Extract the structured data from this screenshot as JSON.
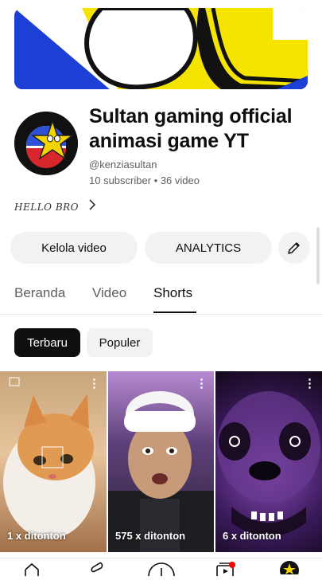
{
  "channel": {
    "title": "Sultan gaming official animasi game YT",
    "handle": "@kenziasultan",
    "stats": "10 subscriber • 36 video",
    "about": "HELLO BRO"
  },
  "actions": {
    "manage_videos": "Kelola video",
    "analytics": "ANALYTICS"
  },
  "tabs": [
    {
      "label": "Beranda"
    },
    {
      "label": "Video"
    },
    {
      "label": "Shorts"
    }
  ],
  "active_tab": "Shorts",
  "filters": [
    {
      "label": "Terbaru"
    },
    {
      "label": "Populer"
    }
  ],
  "active_filter": "Terbaru",
  "shorts": [
    {
      "views": "1 x ditonton"
    },
    {
      "views": "575 x ditonton"
    },
    {
      "views": "6 x ditonton"
    }
  ],
  "nav": [
    "home-icon",
    "shorts-icon",
    "create-icon",
    "subscriptions-icon",
    "you-avatar"
  ],
  "colors": {
    "accent": "#0f0f0f",
    "chip_bg": "#f2f2f2",
    "banner_yellow": "#f5e400",
    "banner_blue": "#1c3fd6",
    "notification": "#ff0000"
  }
}
